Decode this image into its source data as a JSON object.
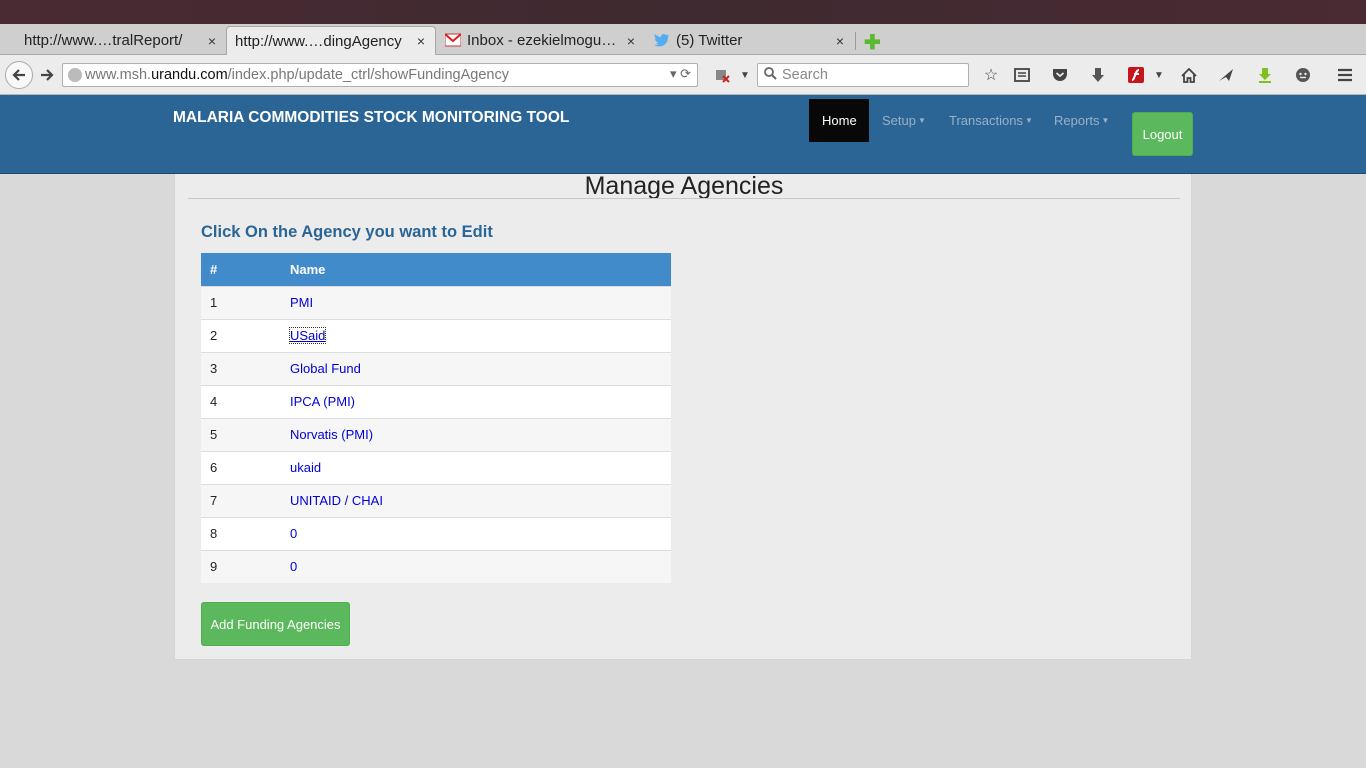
{
  "browser": {
    "tabs": [
      {
        "label": "http://www.…tralReport/",
        "active": false,
        "favicon": "none"
      },
      {
        "label": "http://www.…dingAgency",
        "active": true,
        "favicon": "none"
      },
      {
        "label": "Inbox - ezekielmogu…",
        "active": false,
        "favicon": "gmail-icon"
      },
      {
        "label": "(5) Twitter",
        "active": false,
        "favicon": "twitter-icon"
      }
    ],
    "close_glyph": "×",
    "url": {
      "prefix": "www.msh.",
      "host": "urandu.com",
      "path": "/index.php/update_ctrl/showFundingAgency"
    },
    "search_placeholder": "Search"
  },
  "app": {
    "brand": "MALARIA COMMODITIES STOCK MONITORING TOOL",
    "menu": {
      "home": "Home",
      "setup": "Setup",
      "transactions": "Transactions",
      "reports": "Reports"
    },
    "logout": "Logout",
    "colors": {
      "header": "#2a6596",
      "table_head": "#428bca",
      "button": "#5cb85c"
    }
  },
  "page": {
    "title": "Manage Agencies",
    "instructions": "Click On the Agency you want to Edit",
    "table": {
      "headers": [
        "#",
        "Name"
      ],
      "rows": [
        {
          "num": "1",
          "name": "PMI"
        },
        {
          "num": "2",
          "name": "USaid"
        },
        {
          "num": "3",
          "name": "Global Fund"
        },
        {
          "num": "4",
          "name": "IPCA (PMI)"
        },
        {
          "num": "5",
          "name": "Norvatis (PMI)"
        },
        {
          "num": "6",
          "name": "ukaid"
        },
        {
          "num": "7",
          "name": "UNITAID / CHAI"
        },
        {
          "num": "8",
          "name": "0"
        },
        {
          "num": "9",
          "name": "0"
        }
      ]
    },
    "add_button": "Add Funding Agencies"
  }
}
